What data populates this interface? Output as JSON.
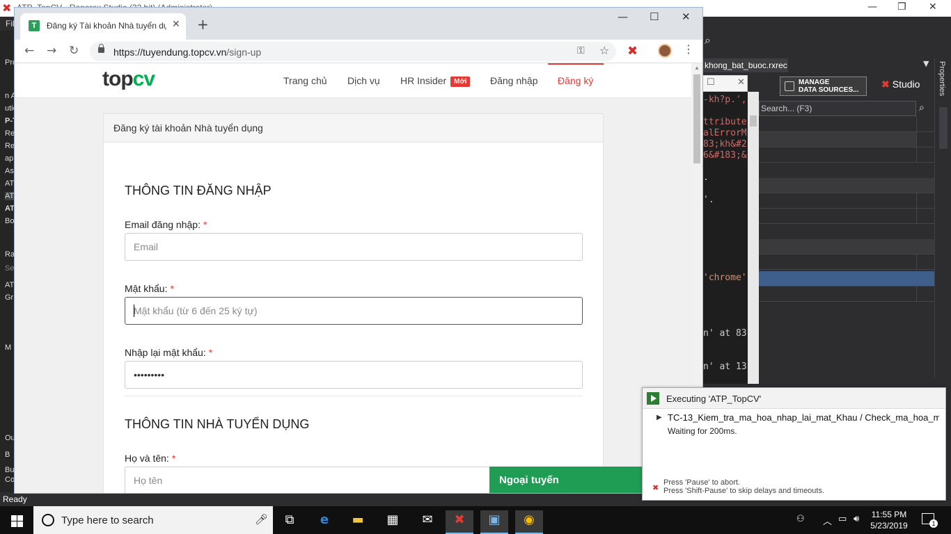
{
  "studio": {
    "title": "ATP_TopCV - Ranorex Studio (32 bit) (Administrator)",
    "menu_file": "Fil",
    "status": "Ready",
    "left_items": [
      "Pro",
      "n A",
      "utio",
      "P-T",
      "Re",
      "Re",
      "ap",
      "As",
      "AT",
      "AT",
      "AT",
      "Bo",
      "Ra",
      "Se",
      "AT",
      "Gr",
      "M",
      "Ou",
      "B",
      "Bu",
      "Co"
    ],
    "doc_tab": "khong_bat_buoc.rxrec",
    "manage_label_1": "MANAGE",
    "manage_label_2": "DATA SOURCES...",
    "studio_logo": "Studio",
    "search_placeholder": "Search... (F3)",
    "properties_label": "Properties",
    "code_lines": [
      "-kh?p.',",
      "ttribute",
      "alErrorM",
      "83;kh&#2",
      "6&#183;&",
      ".",
      "'.",
      "'chrome'",
      "n' at 83",
      "n' at 13"
    ]
  },
  "chrome": {
    "tab_title": "Đăng ký Tài khoản Nhà tuyển dụng",
    "favicon_letter": "T",
    "url_host": "https://tuyendung.topcv.vn",
    "url_path": "/sign-up"
  },
  "site": {
    "logo_top": "top",
    "logo_cv": "cv",
    "nav": {
      "home": "Trang chủ",
      "services": "Dịch vụ",
      "hr_insider": "HR Insider",
      "badge": "Mới",
      "login": "Đăng nhập",
      "register": "Đăng ký"
    },
    "accent": "#00b14f",
    "active_color": "#e53935"
  },
  "form": {
    "card_title": "Đăng ký tài khoản Nhà tuyển dụng",
    "section_login": "THÔNG TIN ĐĂNG NHẬP",
    "email_label": "Email đăng nhập:",
    "email_placeholder": "Email",
    "password_label": "Mật khẩu:",
    "password_placeholder": "Mật khẩu (từ 6 đến 25 ký tự)",
    "confirm_label": "Nhập lại mật khẩu:",
    "confirm_value": "•••••••••",
    "section_company": "THÔNG TIN NHÀ TUYỂN DỤNG",
    "fullname_label": "Họ và tên:",
    "fullname_placeholder": "Họ tên",
    "required_mark": "*"
  },
  "chat": {
    "label": "Ngoại tuyến"
  },
  "exec": {
    "title": "Executing 'ATP_TopCV'",
    "testcase": "TC-13_Kiem_tra_ma_hoa_nhap_lai_mat_Khau  / Check_ma_hoa_ma...",
    "wait": "Waiting for 200ms.",
    "hint_pause": "Press 'Pause' to abort.",
    "hint_shift": "Press 'Shift-Pause' to skip delays and timeouts."
  },
  "taskbar": {
    "search_text": "Type here to search",
    "time": "11:55 PM",
    "date": "5/23/2019",
    "notif_count": "1"
  }
}
